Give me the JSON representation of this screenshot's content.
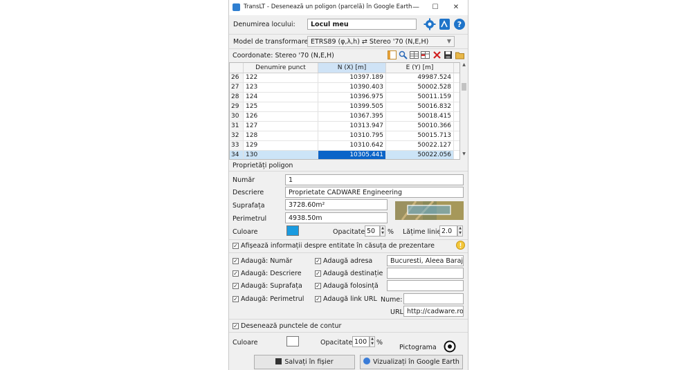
{
  "window": {
    "title": "TransLT - Desenează un poligon (parcelă) în Google Earth",
    "minimize": "—",
    "maximize": "☐",
    "close": "✕"
  },
  "location": {
    "label": "Denumirea locului:",
    "value": "Locul meu"
  },
  "transform": {
    "label": "Model de transformare:",
    "value": "ETRS89 (φ,λ,h) ⇄ Stereo '70 (N,E,H)"
  },
  "coords": {
    "label": "Coordonate: Stereo '70 (N,E,H)"
  },
  "table": {
    "headers": [
      "Denumire punct",
      "N (X) [m]",
      "E (Y) [m]"
    ],
    "rows": [
      {
        "n": "26",
        "name": "122",
        "x": "10397.189",
        "y": "49987.524"
      },
      {
        "n": "27",
        "name": "123",
        "x": "10390.403",
        "y": "50002.528"
      },
      {
        "n": "28",
        "name": "124",
        "x": "10396.975",
        "y": "50011.159"
      },
      {
        "n": "29",
        "name": "125",
        "x": "10399.505",
        "y": "50016.832"
      },
      {
        "n": "30",
        "name": "126",
        "x": "10367.395",
        "y": "50018.415"
      },
      {
        "n": "31",
        "name": "127",
        "x": "10313.947",
        "y": "50010.366"
      },
      {
        "n": "32",
        "name": "128",
        "x": "10310.795",
        "y": "50015.713"
      },
      {
        "n": "33",
        "name": "129",
        "x": "10310.642",
        "y": "50022.127"
      },
      {
        "n": "34",
        "name": "130",
        "x": "10305.441",
        "y": "50022.056"
      }
    ]
  },
  "props": {
    "section": "Proprietăți poligon",
    "numar_label": "Număr",
    "numar": "1",
    "descriere_label": "Descriere",
    "descriere": "Proprietate CADWARE Engineering",
    "suprafata_label": "Suprafața",
    "suprafata": "3728.60m²",
    "perimetrul_label": "Perimetrul",
    "perimetrul": "4938.50m",
    "culoare_label": "Culoare",
    "color": "#1a9be0",
    "opacitate_label": "Opacitate",
    "opacitate": "50",
    "pct": "%",
    "latime_label": "Lățime linie",
    "latime": "2.0"
  },
  "info": {
    "label": "Afișează informații despre entitate în căsuța de prezentare"
  },
  "adds": {
    "numar": "Adaugă: Număr",
    "descriere": "Adaugă: Descriere",
    "suprafata": "Adaugă: Suprafața",
    "perimetrul": "Adaugă: Perimetrul",
    "adresa": "Adaugă adresa",
    "adresa_value": "Bucuresti, Aleea Baraju",
    "destinatie": "Adaugă destinație",
    "folosinta": "Adaugă folosință",
    "link": "Adaugă link URL",
    "nume_label": "Nume:",
    "url_label": "URL",
    "url_value": "http://cadware.ro"
  },
  "contour": {
    "label": "Desenează punctele de contur",
    "culoare_label": "Culoare",
    "color": "#ffffff",
    "opacitate_label": "Opacitate",
    "opacitate": "100",
    "pct": "%",
    "pictograma_label": "Pictograma"
  },
  "buttons": {
    "save": "Salvați în fișier",
    "view": "Vizualizați în Google Earth"
  }
}
